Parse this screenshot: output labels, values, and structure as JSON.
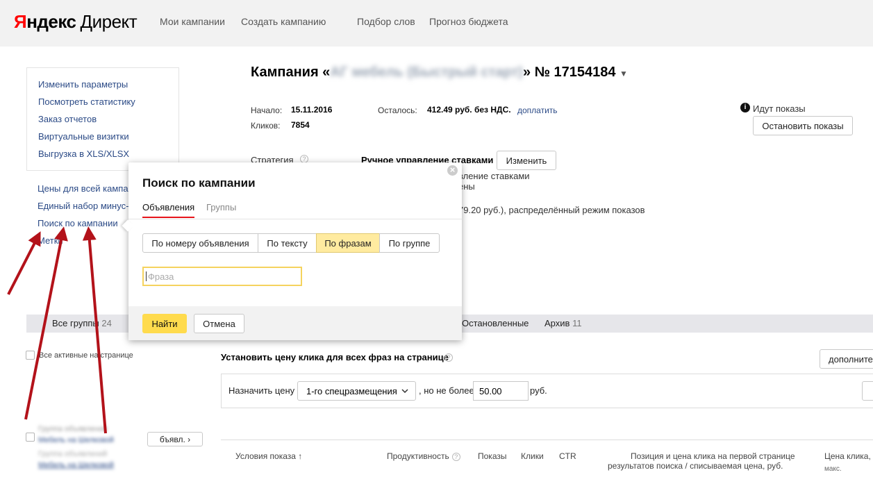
{
  "header": {
    "logo_part1": "Я",
    "logo_part2": "ндекс",
    "logo_part3": "Директ",
    "nav": [
      "Мои кампании",
      "Создать кампанию",
      "Подбор слов",
      "Прогноз бюджета"
    ]
  },
  "sidebar": {
    "box_links": [
      "Изменить параметры",
      "Посмотреть статистику",
      "Заказ отчетов",
      "Виртуальные визитки",
      "Выгрузка в XLS/XLSX"
    ],
    "items": [
      "Цены для всей кампании",
      "Единый набор минус-фраз",
      "Поиск по кампании",
      "Метки"
    ]
  },
  "campaign": {
    "title_prefix": "Кампания «",
    "title_name": "АГ мебель (Быстрый старт)",
    "title_suffix": "» № 17154184",
    "start_label": "Начало:",
    "start_value": "15.11.2016",
    "clicks_label": "Кликов:",
    "clicks_value": "7854",
    "remaining_label": "Осталось:",
    "remaining_value": "412.49 руб. без НДС.",
    "topup_link": "доплатить",
    "status_text": "Идут показы",
    "stop_button": "Остановить показы",
    "strategy_label": "Стратегия",
    "strategy_value": "Ручное управление ставками",
    "change_button": "Изменить",
    "strategy_line2": "вление ставками",
    "strategy_line3": "ены",
    "strategy_line4": "79.20 руб.), распределённый режим показов"
  },
  "filters": {
    "all_groups_label": "Все группы",
    "all_groups_count": "24",
    "stopped_label": "Остановленные",
    "archive_label": "Архив",
    "archive_count": "11"
  },
  "bulk": {
    "all_active_label": "Все активные на странице",
    "set_price_title": "Установить цену клика для всех фраз на странице",
    "more_button": "дополните",
    "assign_price_label": "Назначить цену",
    "position_select": "1-го спецразмещения",
    "not_more_label": ", но не более",
    "price_value": "50.00",
    "currency_label": "руб."
  },
  "group_row": {
    "blurred_line1": "Группа объявлений",
    "blurred_line2": "Мебель на Шелковой",
    "blurred_line3": "Мебель на Шелковой",
    "ads_button": "бъявл. ›"
  },
  "table": {
    "col_conditions": "Условия показа ↑",
    "col_productivity": "Продуктивность",
    "col_impressions": "Показы",
    "col_clicks": "Клики",
    "col_ctr": "CTR",
    "col_position_line1": "Позиция и цена клика на первой странице",
    "col_position_line2": "результатов поиска / списываемая цена, руб.",
    "col_price_line1": "Цена клика,",
    "col_price_line2": "макс."
  },
  "modal": {
    "title": "Поиск по кампании",
    "tabs": [
      "Объявления",
      "Группы"
    ],
    "segments": [
      "По номеру объявления",
      "По тексту",
      "По фразам",
      "По группе"
    ],
    "input_placeholder": "Фраза",
    "find_button": "Найти",
    "cancel_button": "Отмена",
    "close_icon": "×"
  },
  "colors": {
    "accent_yellow": "#ffdb4d",
    "link_blue": "#2b4a86",
    "annotation_red": "#b3121a"
  }
}
